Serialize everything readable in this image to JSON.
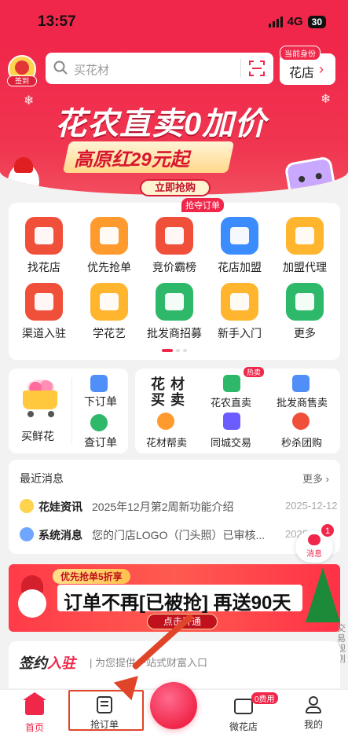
{
  "status": {
    "time": "13:57",
    "network": "4G",
    "battery": "30"
  },
  "header": {
    "sign_label": "签到",
    "search_placeholder": "买花材",
    "role_tag": "当前身份",
    "role_name": "花店"
  },
  "banner": {
    "title": "花农直卖0加价",
    "subtitle": "高原红29元起",
    "cta": "立即抢购"
  },
  "grid": {
    "badge": "抢夺订单",
    "items": [
      {
        "label": "找花店",
        "icon": "store-search-icon",
        "color": "#f0503a"
      },
      {
        "label": "优先抢单",
        "icon": "lightning-icon",
        "color": "#ff9a2e"
      },
      {
        "label": "竞价霸榜",
        "icon": "megaphone-icon",
        "color": "#f0503a"
      },
      {
        "label": "花店加盟",
        "icon": "crown-icon",
        "color": "#3b8cff"
      },
      {
        "label": "加盟代理",
        "icon": "agent-icon",
        "color": "#ffb52e"
      },
      {
        "label": "渠道入驻",
        "icon": "channel-icon",
        "color": "#f0503a"
      },
      {
        "label": "学花艺",
        "icon": "graduation-cap-icon",
        "color": "#ffb52e"
      },
      {
        "label": "批发商招募",
        "icon": "tulip-icon",
        "color": "#2eb86a"
      },
      {
        "label": "新手入门",
        "icon": "book-icon",
        "color": "#ffb52e"
      },
      {
        "label": "更多",
        "icon": "more-grid-icon",
        "color": "#2eb86a"
      }
    ]
  },
  "shortcuts": {
    "buy_flowers": "买鲜花",
    "place_order": "下订单",
    "check_order": "查订单",
    "flower_buy_sell_line1": "花 材",
    "flower_buy_sell_line2": "买 卖",
    "hot_tag": "热卖",
    "farmer_direct": "花农直卖",
    "wholesaler_sale": "批发商售卖",
    "material_help": "花材帮卖",
    "local_trade": "同城交易",
    "flash_group": "秒杀团购"
  },
  "news": {
    "heading": "最近消息",
    "more": "更多",
    "items": [
      {
        "source": "花娃资讯",
        "text": "2025年12月第2周新功能介绍",
        "date": "2025-12-12"
      },
      {
        "source": "系统消息",
        "text": "您的门店LOGO（门头照）已审核...",
        "date": "2025"
      }
    ],
    "fab_label": "消息",
    "fab_count": "1"
  },
  "promo": {
    "tag": "优先抢单5折享",
    "main": "订单不再[已被抢] 再送90天",
    "cta": "点击开通"
  },
  "side_note": "交易规则",
  "sign_section": {
    "title_prefix": "签约",
    "title_highlight": "入驻",
    "subtitle": "| 为您提供一站式财富入口"
  },
  "tabbar": {
    "home": "首页",
    "grab_orders": "抢订单",
    "mini_store": "微花店",
    "mini_store_badge": "0费用",
    "me": "我的"
  },
  "colors": {
    "brand": "#f0274a",
    "annotation": "#e0452a"
  }
}
